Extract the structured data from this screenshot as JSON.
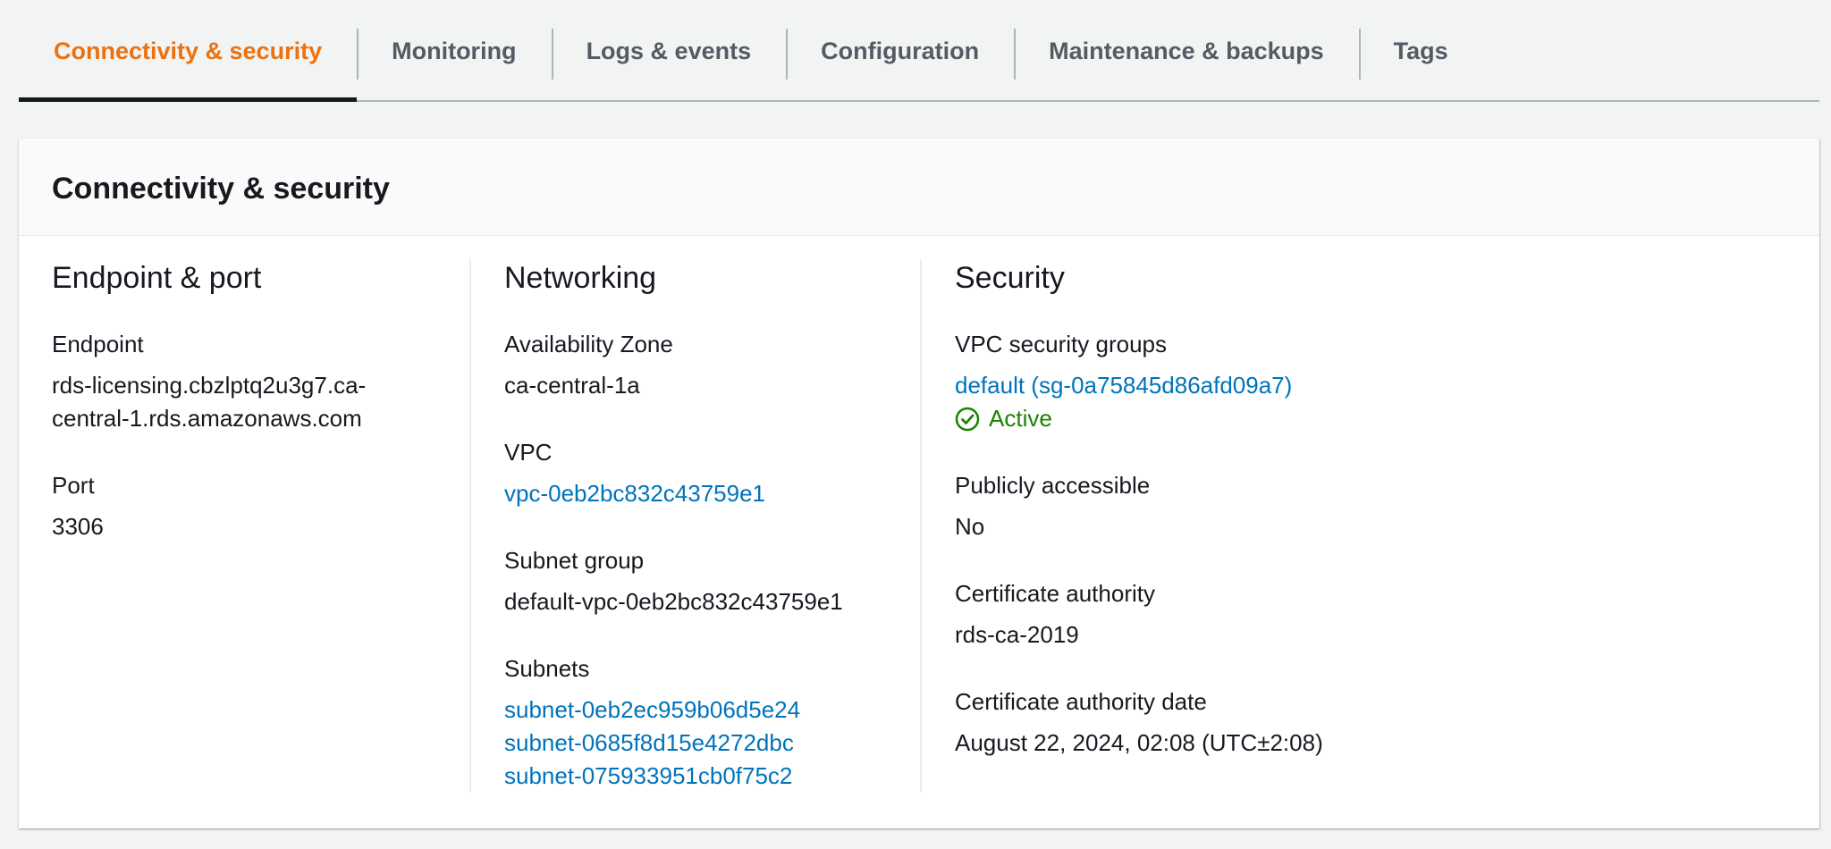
{
  "tabs": [
    {
      "label": "Connectivity & security",
      "active": true
    },
    {
      "label": "Monitoring"
    },
    {
      "label": "Logs & events"
    },
    {
      "label": "Configuration"
    },
    {
      "label": "Maintenance & backups"
    },
    {
      "label": "Tags"
    }
  ],
  "panel": {
    "title": "Connectivity & security",
    "endpoint_port": {
      "title": "Endpoint & port",
      "endpoint_label": "Endpoint",
      "endpoint_value": "rds-licensing.cbzlptq2u3g7.ca-central-1.rds.amazonaws.com",
      "port_label": "Port",
      "port_value": "3306"
    },
    "networking": {
      "title": "Networking",
      "az_label": "Availability Zone",
      "az_value": "ca-central-1a",
      "vpc_label": "VPC",
      "vpc_value": "vpc-0eb2bc832c43759e1",
      "subnet_group_label": "Subnet group",
      "subnet_group_value": "default-vpc-0eb2bc832c43759e1",
      "subnets_label": "Subnets",
      "subnets": [
        "subnet-0eb2ec959b06d5e24",
        "subnet-0685f8d15e4272dbc",
        "subnet-075933951cb0f75c2"
      ]
    },
    "security": {
      "title": "Security",
      "sg_label": "VPC security groups",
      "sg_value": "default (sg-0a75845d86afd09a7)",
      "sg_status": "Active",
      "public_label": "Publicly accessible",
      "public_value": "No",
      "ca_label": "Certificate authority",
      "ca_value": "rds-ca-2019",
      "ca_date_label": "Certificate authority date",
      "ca_date_value": "August 22, 2024, 02:08 (UTC±2:08)"
    }
  },
  "colors": {
    "accent": "#ec7211",
    "link": "#0073bb",
    "success": "#1d8102"
  },
  "icons": {
    "status": "status-positive-icon"
  }
}
